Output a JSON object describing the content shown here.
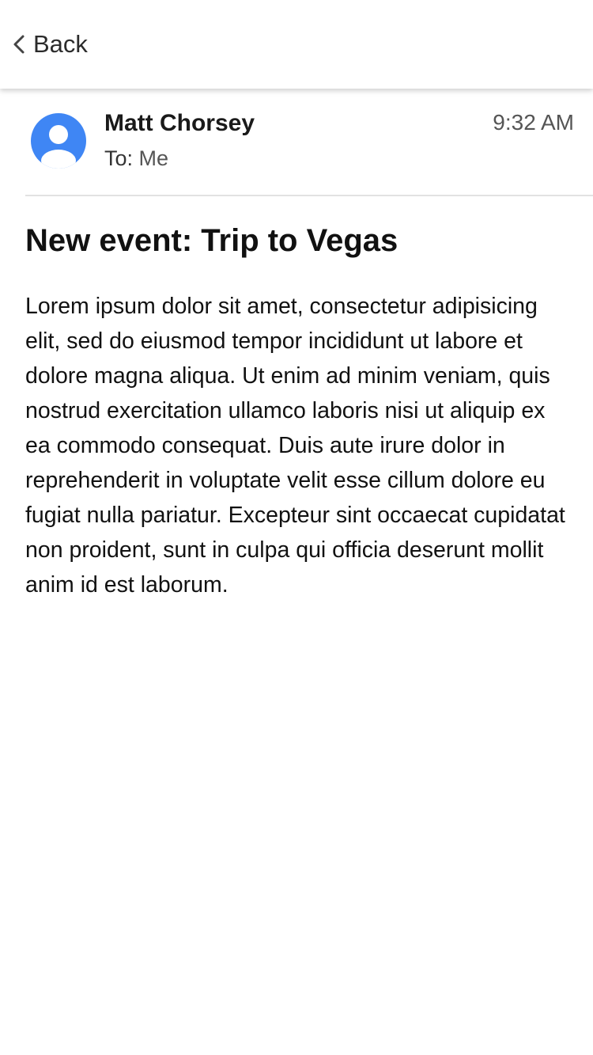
{
  "nav": {
    "back_label": "Back",
    "back_icon": "chevron-left-icon"
  },
  "email": {
    "sender": "Matt Chorsey",
    "to_prefix": "To:",
    "recipient": "Me",
    "time": "9:32 AM",
    "avatar_icon": "person-avatar-icon",
    "subject": "New event: Trip to Vegas",
    "body": "Lorem ipsum dolor sit amet, consectetur adipisicing elit, sed do eiusmod tempor incididunt ut labore et dolore magna aliqua. Ut enim ad minim veniam, quis nostrud exercitation ullamco laboris nisi ut aliquip ex ea commodo consequat. Duis aute irure dolor in reprehenderit in voluptate velit esse cillum dolore eu fugiat nulla pariatur. Excepteur sint occaecat cupidatat non proident, sunt in culpa qui officia deserunt mollit anim id est laborum."
  },
  "colors": {
    "avatar_blue": "#3f86f4",
    "divider": "#e2e2e2"
  }
}
